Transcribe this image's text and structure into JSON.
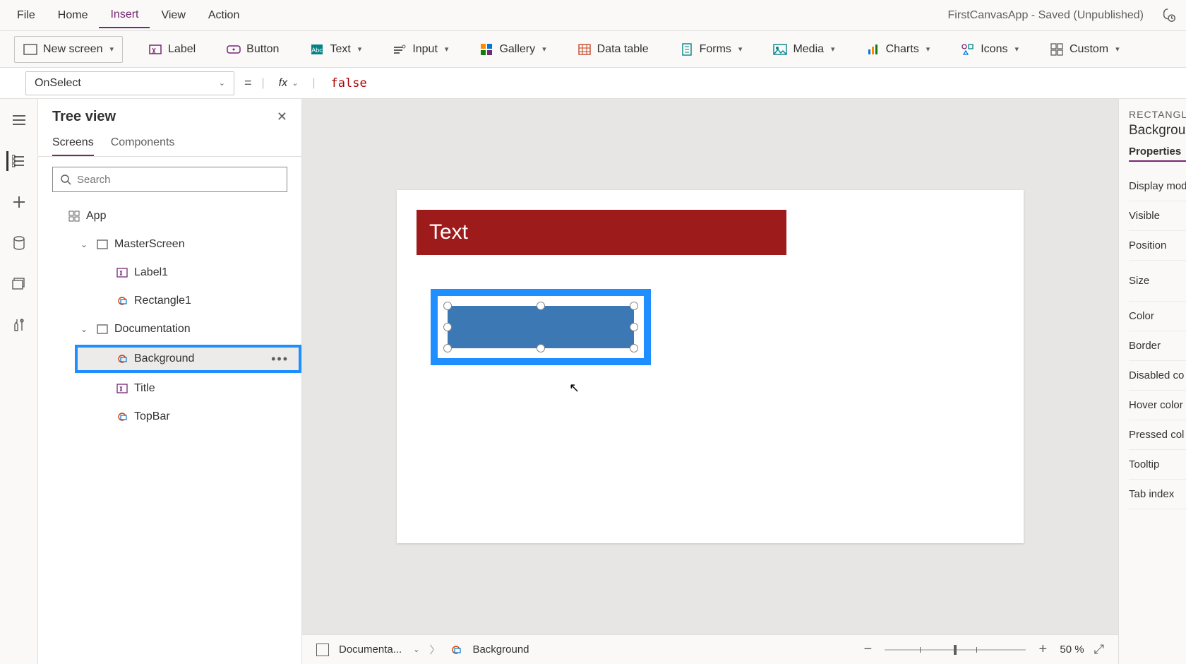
{
  "app_title": "FirstCanvasApp - Saved (Unpublished)",
  "menubar": [
    "File",
    "Home",
    "Insert",
    "View",
    "Action"
  ],
  "menubar_active_index": 2,
  "ribbon": {
    "new_screen": "New screen",
    "label": "Label",
    "button": "Button",
    "text": "Text",
    "input": "Input",
    "gallery": "Gallery",
    "data_table": "Data table",
    "forms": "Forms",
    "media": "Media",
    "charts": "Charts",
    "icons": "Icons",
    "custom": "Custom"
  },
  "formula": {
    "property": "OnSelect",
    "equals": "=",
    "fx": "fx",
    "value": "false"
  },
  "tree": {
    "title": "Tree view",
    "tabs": [
      "Screens",
      "Components"
    ],
    "tabs_active_index": 0,
    "search_placeholder": "Search",
    "app_label": "App",
    "items": [
      {
        "caret": "v",
        "label": "MasterScreen",
        "type": "screen",
        "children": [
          {
            "label": "Label1",
            "type": "label"
          },
          {
            "label": "Rectangle1",
            "type": "rect"
          }
        ]
      },
      {
        "caret": "v",
        "label": "Documentation",
        "type": "screen",
        "children": [
          {
            "label": "Background",
            "type": "rect",
            "selected": true
          },
          {
            "label": "Title",
            "type": "label"
          },
          {
            "label": "TopBar",
            "type": "rect"
          }
        ]
      }
    ]
  },
  "canvas": {
    "red_bar_text": "Text"
  },
  "statusbar": {
    "screen_label": "Documenta...",
    "selection_label": "Background",
    "zoom_text": "50  %"
  },
  "props": {
    "type_label": "RECTANGLE",
    "name": "Backgroun",
    "tab": "Properties",
    "rows": [
      "Display mod",
      "Visible",
      "Position",
      "Size",
      "Color",
      "Border",
      "Disabled co",
      "Hover color",
      "Pressed col",
      "Tooltip",
      "Tab index"
    ]
  }
}
